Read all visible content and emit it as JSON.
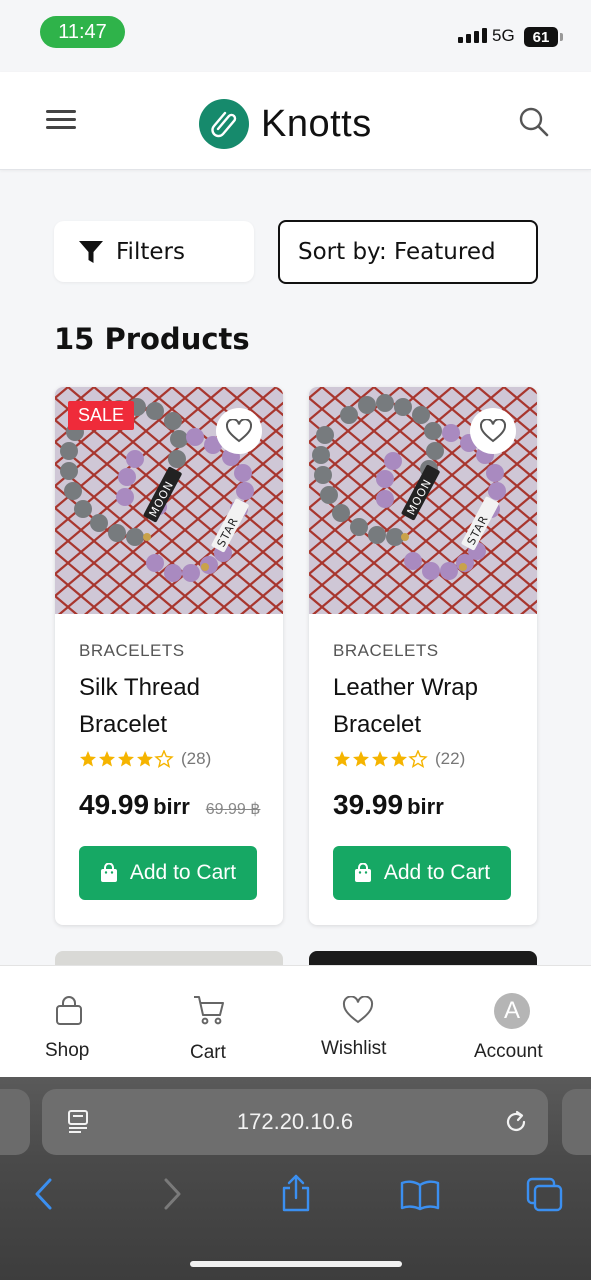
{
  "status": {
    "time": "11:47",
    "network": "5G",
    "battery": "61"
  },
  "header": {
    "brand": "Knotts"
  },
  "toolbar": {
    "filters_label": "Filters",
    "sort_label": "Sort by: Featured"
  },
  "catalog": {
    "count_label": "15 Products"
  },
  "products": [
    {
      "badge": "SALE",
      "category": "BRACELETS",
      "name": "Silk Thread Bracelet",
      "rating": 4,
      "reviews": "(28)",
      "price": "49.99",
      "currency": "birr",
      "old_price": "69.99 ฿",
      "button": "Add to Cart"
    },
    {
      "badge": "",
      "category": "BRACELETS",
      "name": "Leather Wrap Bracelet",
      "rating": 4,
      "reviews": "(22)",
      "price": "39.99",
      "currency": "birr",
      "old_price": "",
      "button": "Add to Cart"
    }
  ],
  "bottom_nav": [
    {
      "label": "Shop",
      "icon": "bag-icon"
    },
    {
      "label": "Cart",
      "icon": "cart-icon"
    },
    {
      "label": "Wishlist",
      "icon": "heart-icon"
    },
    {
      "label": "Account",
      "icon": "avatar",
      "initial": "A"
    }
  ],
  "browser": {
    "url": "172.20.10.6"
  },
  "colors": {
    "brand": "#168a6c",
    "sale": "#ef2b3a",
    "cart_button": "#16a864",
    "star": "#f5b400"
  }
}
